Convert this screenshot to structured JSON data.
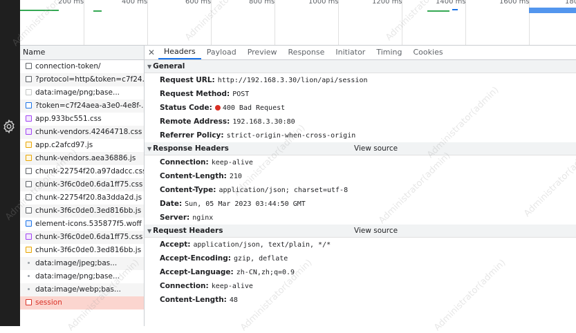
{
  "timeline": {
    "ticks": [
      "200 ms",
      "400 ms",
      "600 ms",
      "800 ms",
      "1000 ms",
      "1200 ms",
      "1400 ms",
      "1600 ms",
      "180"
    ]
  },
  "name_column": {
    "header": "Name",
    "requests": [
      {
        "name": "connection-token/",
        "icon": "document-icon"
      },
      {
        "name": "?protocol=http&token=c7f24...",
        "icon": "document-icon"
      },
      {
        "name": "data:image/png;base...",
        "icon": "document-icon"
      },
      {
        "name": "?token=c7f24aea-a3e0-4e8f-...",
        "icon": "document-icon"
      },
      {
        "name": "app.933bc551.css",
        "icon": "css-icon"
      },
      {
        "name": "chunk-vendors.42464718.css",
        "icon": "css-icon"
      },
      {
        "name": "app.c2afcd97.js",
        "icon": "js-icon"
      },
      {
        "name": "chunk-vendors.aea36886.js",
        "icon": "js-icon"
      },
      {
        "name": "chunk-22754f20.a97dadcc.css",
        "icon": "document-icon"
      },
      {
        "name": "chunk-3f6c0de0.6da1ff75.css",
        "icon": "document-icon"
      },
      {
        "name": "chunk-22754f20.8a3dda2d.js",
        "icon": "document-icon"
      },
      {
        "name": "chunk-3f6c0de0.3ed816bb.js",
        "icon": "document-icon"
      },
      {
        "name": "element-icons.535877f5.woff",
        "icon": "font-icon"
      },
      {
        "name": "chunk-3f6c0de0.6da1ff75.css",
        "icon": "css-icon"
      },
      {
        "name": "chunk-3f6c0de0.3ed816bb.js",
        "icon": "js-icon"
      },
      {
        "name": "data:image/jpeg;bas...",
        "icon": "image-icon"
      },
      {
        "name": "data:image/png;base...",
        "icon": "image-icon"
      },
      {
        "name": "data:image/webp;bas...",
        "icon": "image-icon"
      },
      {
        "name": "session",
        "icon": "document-icon",
        "selected": true
      }
    ]
  },
  "tabs": [
    "Headers",
    "Payload",
    "Preview",
    "Response",
    "Initiator",
    "Timing",
    "Cookies"
  ],
  "active_tab": "Headers",
  "general": {
    "title": "General",
    "rows": [
      {
        "key": "Request URL:",
        "value": "http://192.168.3.30/lion/api/session"
      },
      {
        "key": "Request Method:",
        "value": "POST"
      },
      {
        "key": "Status Code:",
        "value": "400 Bad Request"
      },
      {
        "key": "Remote Address:",
        "value": "192.168.3.30:80"
      },
      {
        "key": "Referrer Policy:",
        "value": "strict-origin-when-cross-origin"
      }
    ]
  },
  "response_headers": {
    "title": "Response Headers",
    "view_source": "View source",
    "rows": [
      {
        "key": "Connection:",
        "value": "keep-alive"
      },
      {
        "key": "Content-Length:",
        "value": "210"
      },
      {
        "key": "Content-Type:",
        "value": "application/json; charset=utf-8"
      },
      {
        "key": "Date:",
        "value": "Sun, 05 Mar 2023 03:44:50 GMT"
      },
      {
        "key": "Server:",
        "value": "nginx"
      }
    ]
  },
  "request_headers": {
    "title": "Request Headers",
    "view_source": "View source",
    "rows": [
      {
        "key": "Accept:",
        "value": "application/json, text/plain, */*"
      },
      {
        "key": "Accept-Encoding:",
        "value": "gzip, deflate"
      },
      {
        "key": "Accept-Language:",
        "value": "zh-CN,zh;q=0.9"
      },
      {
        "key": "Connection:",
        "value": "keep-alive"
      },
      {
        "key": "Content-Length:",
        "value": "48"
      }
    ]
  },
  "watermark_text": "Administrator(admin)"
}
